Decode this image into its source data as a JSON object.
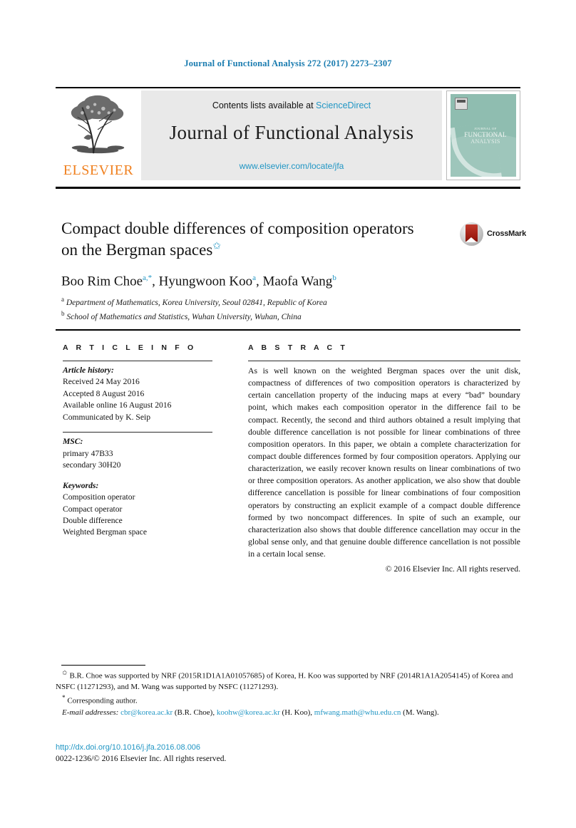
{
  "running_head": "Journal of Functional Analysis 272 (2017) 2273–2307",
  "masthead": {
    "contents_prefix": "Contents lists available at ",
    "sciencedirect": "ScienceDirect",
    "journal_title": "Journal of Functional Analysis",
    "journal_url": "www.elsevier.com/locate/jfa",
    "publisher": "ELSEVIER",
    "cover": {
      "line1": "JOURNAL OF",
      "line2": "FUNCTIONAL",
      "line3": "ANALYSIS",
      "bg_color": "#8fbdb0"
    }
  },
  "article": {
    "title": "Compact double differences of composition operators on the Bergman spaces",
    "title_footnote_symbol": "✩",
    "crossmark_label": "CrossMark",
    "authors": "Boo Rim Choe a,*, Hyungwoon Koo a, Maofa Wang b",
    "author_list": [
      {
        "name": "Boo Rim Choe",
        "marks": "a,*"
      },
      {
        "name": "Hyungwoon Koo",
        "marks": "a"
      },
      {
        "name": "Maofa Wang",
        "marks": "b"
      }
    ],
    "affiliations": [
      {
        "mark": "a",
        "text": "Department of Mathematics, Korea University, Seoul 02841, Republic of Korea"
      },
      {
        "mark": "b",
        "text": "School of Mathematics and Statistics, Wuhan University, Wuhan, China"
      }
    ]
  },
  "info": {
    "header_article_info": "A R T I C L E   I N F O",
    "header_abstract": "A B S T R A C T",
    "history_label": "Article history:",
    "history": [
      "Received 24 May 2016",
      "Accepted 8 August 2016",
      "Available online 16 August 2016",
      "Communicated by K. Seip"
    ],
    "msc_label": "MSC:",
    "msc": [
      "primary 47B33",
      "secondary 30H20"
    ],
    "keywords_label": "Keywords:",
    "keywords": [
      "Composition operator",
      "Compact operator",
      "Double difference",
      "Weighted Bergman space"
    ]
  },
  "abstract": {
    "text": "As is well known on the weighted Bergman spaces over the unit disk, compactness of differences of two composition operators is characterized by certain cancellation property of the inducing maps at every “bad” boundary point, which makes each composition operator in the difference fail to be compact. Recently, the second and third authors obtained a result implying that double difference cancellation is not possible for linear combinations of three composition operators. In this paper, we obtain a complete characterization for compact double differences formed by four composition operators. Applying our characterization, we easily recover known results on linear combinations of two or three composition operators. As another application, we also show that double difference cancellation is possible for linear combinations of four composition operators by constructing an explicit example of a compact double difference formed by two noncompact differences. In spite of such an example, our characterization also shows that double difference cancellation may occur in the global sense only, and that genuine double difference cancellation is not possible in a certain local sense.",
    "copyright": "© 2016 Elsevier Inc. All rights reserved."
  },
  "footnotes": {
    "funding": "B.R. Choe was supported by NRF (2015R1D1A1A01057685) of Korea, H. Koo was supported by NRF (2014R1A1A2054145) of Korea and NSFC (11271293), and M. Wang was supported by NSFC (11271293).",
    "corresponding": "Corresponding author.",
    "email_label": "E-mail addresses:",
    "emails": [
      {
        "address": "cbr@korea.ac.kr",
        "owner": "(B.R. Choe),"
      },
      {
        "address": "koohw@korea.ac.kr",
        "owner": "(H. Koo),"
      },
      {
        "address": "mfwang.math@whu.edu.cn",
        "owner": "(M. Wang)."
      }
    ],
    "star_symbol": "✩",
    "asterisk_symbol": "*"
  },
  "footer": {
    "doi": "http://dx.doi.org/10.1016/j.jfa.2016.08.006",
    "issn_line": "0022-1236/© 2016 Elsevier Inc. All rights reserved."
  }
}
